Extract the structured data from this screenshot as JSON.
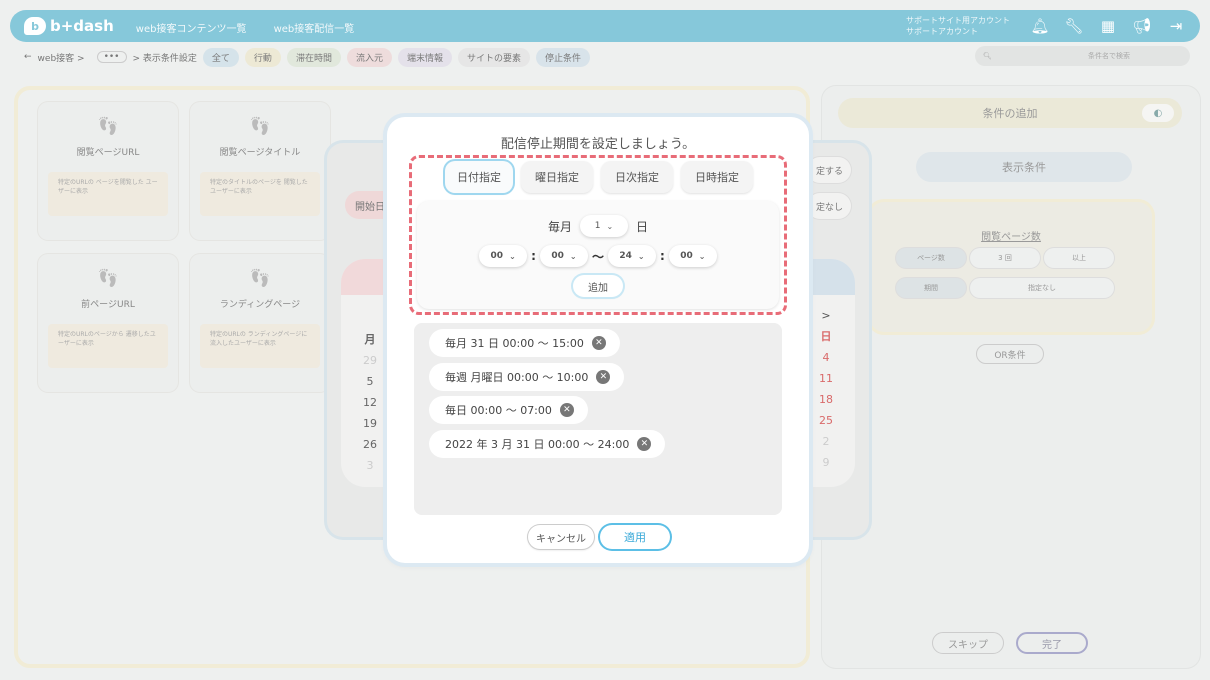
{
  "topbar": {
    "logo": "b+dash",
    "nav": [
      "web接客コンテンツ一覧",
      "web接客配信一覧"
    ],
    "account_line1": "サポートサイト用アカウント",
    "account_line2": "サポートアカウント",
    "icons": [
      "bell-icon",
      "wrench-icon",
      "grid-icon",
      "megaphone-icon",
      "logout-icon"
    ]
  },
  "subbar": {
    "back": "←",
    "crumb1": "web接客 >",
    "dots": "•••",
    "crumb2": "> 表示条件設定",
    "chips": [
      "全て",
      "行動",
      "滞在時間",
      "流入元",
      "端末情報",
      "サイトの要素",
      "停止条件"
    ],
    "search_placeholder": "条件名で検索"
  },
  "left_cards": [
    {
      "title": "閲覧ページURL",
      "desc": "特定のURLの ページを閲覧した ユーザーに表示"
    },
    {
      "title": "閲覧ページタイトル",
      "desc": "特定のタイトルのページを 閲覧したユーザーに表示"
    },
    {
      "title": "前ページURL",
      "desc": "特定のURLのページから 遷移したユーザーに表示"
    },
    {
      "title": "ランディングページ",
      "desc": "特定のURLの ランディングページに 流入したユーザーに表示"
    }
  ],
  "right_panel": {
    "header": "条件の追加",
    "display": "表示条件",
    "box_label": "閲覧ページ数",
    "row1": [
      "ページ数",
      "3 回",
      "以上"
    ],
    "row2": [
      "期間",
      "指定なし"
    ],
    "or": "OR条件",
    "skip": "スキップ",
    "done": "完了"
  },
  "mid_modal": {
    "start": "開始日",
    "btn1": "定する",
    "btn2": "定なし",
    "left_col": [
      "月",
      "29",
      "5",
      "12",
      "19",
      "26",
      "3"
    ],
    "right_col": [
      ">",
      "日",
      "4",
      "11",
      "18",
      "25",
      "2",
      "9"
    ]
  },
  "dialog": {
    "title": "配信停止期間を設定しましょう。",
    "tabs": [
      "日付指定",
      "曜日指定",
      "日次指定",
      "日時指定"
    ],
    "active_tab": 0,
    "monthly_label": "毎月",
    "day_value": "1",
    "day_suffix": "日",
    "start_hour": "00",
    "start_min": "00",
    "end_hour": "24",
    "end_min": "00",
    "colon": ":",
    "tilde": "〜",
    "add": "追加",
    "entries": [
      "毎月 31 日 00:00 〜 15:00",
      "毎週 月曜日 00:00 〜 10:00",
      "毎日 00:00 〜 07:00",
      "2022 年 3 月 31 日 00:00 〜 24:00"
    ],
    "cancel": "キャンセル",
    "apply": "適用"
  },
  "colors": {
    "accent": "#5cbfe6",
    "dash": "#e86c78",
    "topbar": "#86c8da"
  }
}
